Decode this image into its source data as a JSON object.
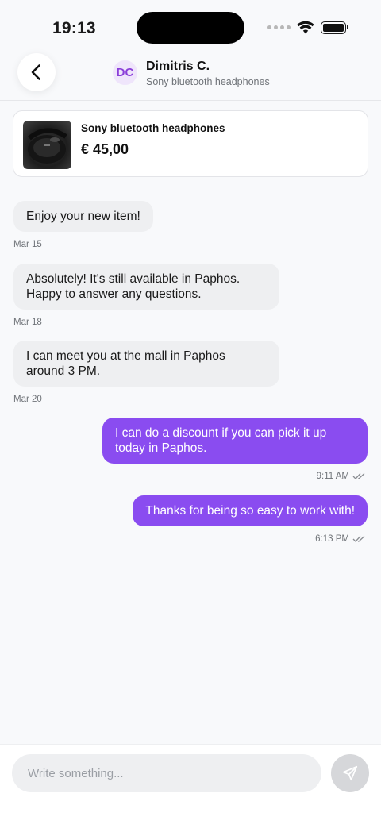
{
  "status_bar": {
    "time": "19:13"
  },
  "header": {
    "avatar_initials": "DC",
    "name": "Dimitris C.",
    "subtitle": "Sony bluetooth headphones"
  },
  "product": {
    "title": "Sony bluetooth headphones",
    "price": "€ 45,00"
  },
  "messages": [
    {
      "direction": "incoming",
      "text": "Enjoy your new item!",
      "date": "Mar 15"
    },
    {
      "direction": "incoming",
      "text": "Absolutely! It's still available in Paphos. Happy to answer any questions.",
      "date": "Mar 18"
    },
    {
      "direction": "incoming",
      "text": "I can meet you at the mall in Paphos around 3 PM.",
      "date": "Mar 20"
    },
    {
      "direction": "outgoing",
      "text": "I can do a discount if you can pick it up today in Paphos.",
      "time": "9:11 AM",
      "status_icon": "double-check-icon"
    },
    {
      "direction": "outgoing",
      "text": "Thanks for being so easy to work with!",
      "time": "6:13 PM",
      "status_icon": "double-check-icon"
    }
  ],
  "composer": {
    "placeholder": "Write something..."
  },
  "colors": {
    "accent": "#8a4cf0",
    "avatar_bg": "#efe5fb",
    "avatar_text": "#8b3fd9",
    "incoming_bubble": "#eeeff1",
    "send_button": "#d6d7da"
  }
}
